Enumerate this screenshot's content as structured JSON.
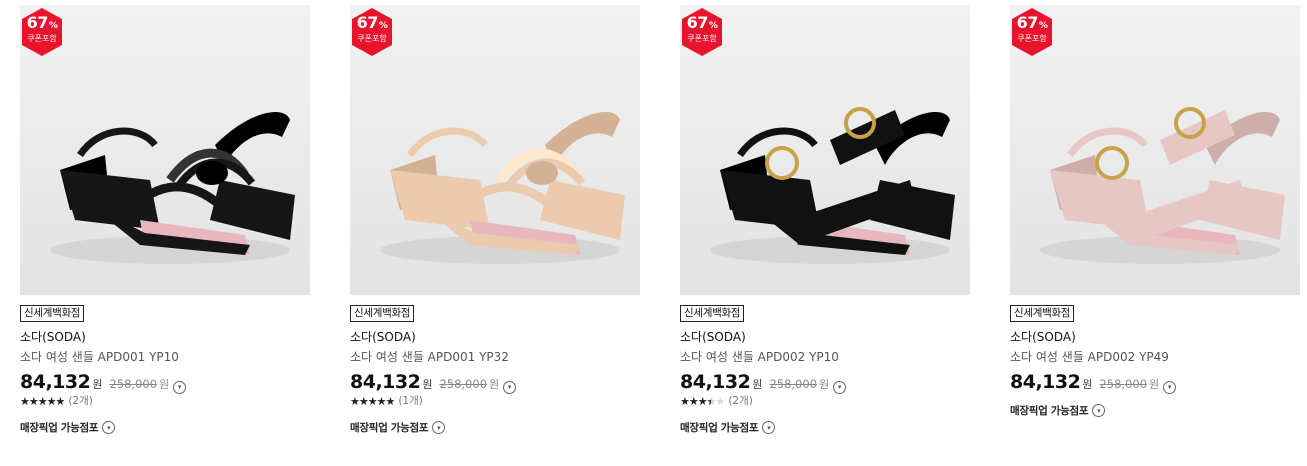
{
  "products": [
    {
      "discount": "67",
      "pct_sign": "%",
      "coupon": "쿠폰포함",
      "store": "신세계백화점",
      "brand": "소다(SODA)",
      "name": "소다 여성 샌들 APD001 YP10",
      "price": "84,132",
      "currency": "원",
      "orig_price": "258,000",
      "orig_currency": "원",
      "info_icon": "chevron-down-icon",
      "rating": 5,
      "rating_count": "(2개)",
      "pickup": "매장픽업 가능점포",
      "shoe_style": "knot",
      "shoe_color": "#161616"
    },
    {
      "discount": "67",
      "pct_sign": "%",
      "coupon": "쿠폰포함",
      "store": "신세계백화점",
      "brand": "소다(SODA)",
      "name": "소다 여성 샌들 APD001 YP32",
      "price": "84,132",
      "currency": "원",
      "orig_price": "258,000",
      "orig_currency": "원",
      "info_icon": "chevron-down-icon",
      "rating": 5,
      "rating_count": "(1개)",
      "pickup": "매장픽업 가능점포",
      "shoe_style": "knot",
      "shoe_color": "#ebcaad"
    },
    {
      "discount": "67",
      "pct_sign": "%",
      "coupon": "쿠폰포함",
      "store": "신세계백화점",
      "brand": "소다(SODA)",
      "name": "소다 여성 샌들 APD002 YP10",
      "price": "84,132",
      "currency": "원",
      "orig_price": "258,000",
      "orig_currency": "원",
      "info_icon": "chevron-down-icon",
      "rating": 3.5,
      "rating_count": "(2개)",
      "pickup": "매장픽업 가능점포",
      "shoe_style": "buckle",
      "shoe_color": "#111111"
    },
    {
      "discount": "67",
      "pct_sign": "%",
      "coupon": "쿠폰포함",
      "store": "신세계백화점",
      "brand": "소다(SODA)",
      "name": "소다 여성 샌들 APD002 YP49",
      "price": "84,132",
      "currency": "원",
      "orig_price": "258,000",
      "orig_currency": "원",
      "info_icon": "chevron-down-icon",
      "rating": null,
      "rating_count": "",
      "pickup": "매장픽업 가능점포",
      "shoe_style": "buckle",
      "shoe_color": "#e7c7c3"
    }
  ],
  "colors": {
    "badge_red": "#e8132c",
    "star_filled": "#222222",
    "star_empty": "#d6d6d6"
  },
  "stars_glyph": "★★★★★"
}
